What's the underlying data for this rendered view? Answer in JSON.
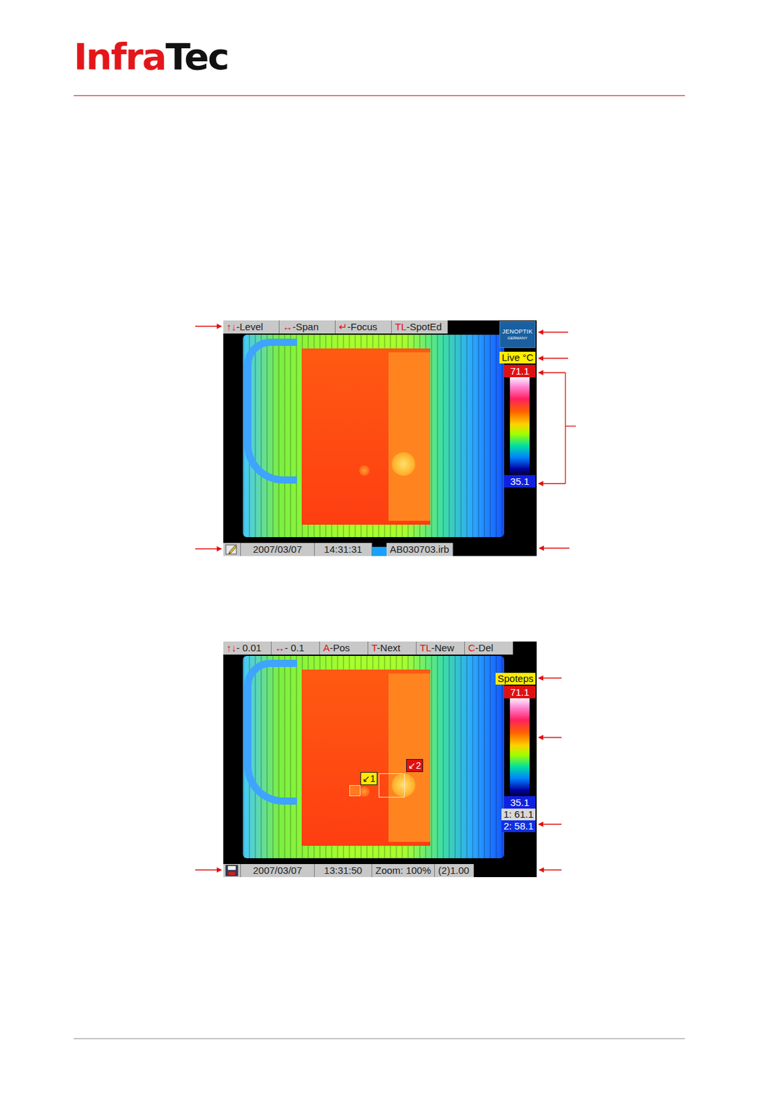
{
  "header": {
    "logo_primary": "Infra",
    "logo_secondary": "Tec"
  },
  "screens": [
    {
      "kind": "live",
      "toolbar": [
        {
          "key": "↑↓",
          "label": "-Level"
        },
        {
          "key": "↔",
          "label": "-Span"
        },
        {
          "key": "↵",
          "label": "-Focus"
        },
        {
          "key": "TL",
          "label": "-SpotEd"
        }
      ],
      "brand": {
        "name": "JENOPTIK",
        "country": "GERMANY"
      },
      "mode": "Live °C",
      "scale": {
        "max": "71.1",
        "min": "35.1"
      },
      "spots": [],
      "readings": [],
      "status": {
        "date": "2007/03/07",
        "time": "14:31:31",
        "fields": [
          {
            "kind": "file",
            "text": "AB030703.irb"
          }
        ]
      }
    },
    {
      "kind": "edit",
      "toolbar": [
        {
          "key": "↑↓",
          "label": "- 0.01"
        },
        {
          "key": "↔",
          "label": "- 0.1"
        },
        {
          "key": "A",
          "label": "-Pos"
        },
        {
          "key": "T",
          "label": "-Next"
        },
        {
          "key": "TL",
          "label": "-New"
        },
        {
          "key": "C",
          "label": "-Del"
        }
      ],
      "brand": null,
      "mode": "Spoteps",
      "scale": {
        "max": "71.1",
        "min": "35.1"
      },
      "spots": [
        {
          "label": "↙1",
          "color": "#ffe800"
        },
        {
          "label": "↙2",
          "color": "#e01010"
        }
      ],
      "readings": [
        {
          "text": "1: 61.1",
          "color": "#d8d8d8"
        },
        {
          "text": "2: 58.1",
          "color": "#1030e0"
        }
      ],
      "status": {
        "date": "2007/03/07",
        "time": "13:31:50",
        "fields": [
          {
            "kind": "text",
            "text": "Zoom: 100%"
          },
          {
            "kind": "text",
            "text": "(2)1.00"
          }
        ]
      }
    }
  ]
}
